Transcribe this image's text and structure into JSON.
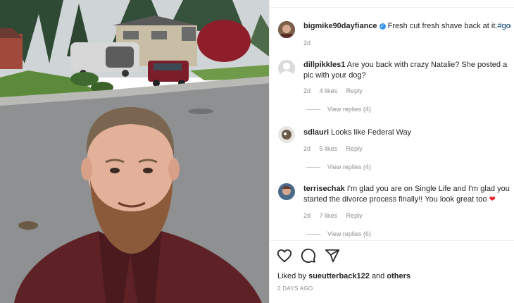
{
  "post": {
    "author": "bigmike90dayfiance",
    "caption": "Fresh cut fresh shave back at it.",
    "hashtag": "#goodvib",
    "age": "2d"
  },
  "comments": [
    {
      "user": "dillpikkles1",
      "text": "Are you back with crazy Natalie? She posted a pic with your dog?",
      "age": "2d",
      "likes": "4 likes",
      "reply": "Reply",
      "view_replies": "View replies (4)"
    },
    {
      "user": "sdlauri",
      "text": "Looks like Federal Way",
      "age": "2d",
      "likes": "5 likes",
      "reply": "Reply",
      "view_replies": "View replies (4)"
    },
    {
      "user": "terrisechak",
      "text": "I'm glad you are on Single Life and I'm glad you started the divorce process finally!! You look great too",
      "emoji": "❤",
      "age": "2d",
      "likes": "7 likes",
      "reply": "Reply",
      "view_replies": "View replies (6)"
    }
  ],
  "likes_summary": {
    "prefix": "Liked by",
    "user": "sueutterback122",
    "conj": "and",
    "others": "others"
  },
  "timestamp": "2 DAYS AGO",
  "icons": [
    "heart-outline-icon",
    "comment-icon",
    "share-icon",
    "verified-badge-icon"
  ],
  "colors": {
    "link": "#00376b",
    "verified": "#3897f0",
    "heart": "#ed1c24",
    "muted": "#8e8e8e"
  }
}
